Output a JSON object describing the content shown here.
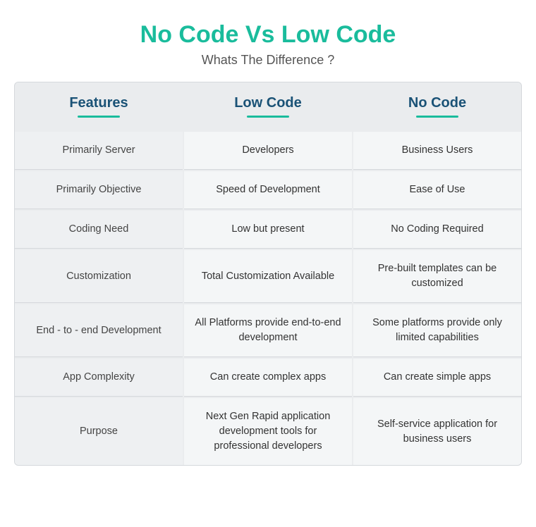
{
  "title": {
    "part1": "No Code Vs ",
    "part2": "Low Code",
    "subtitle": "Whats The Difference ?"
  },
  "headers": {
    "features": "Features",
    "lowcode": "Low Code",
    "nocode": "No Code"
  },
  "rows": [
    {
      "feature": "Primarily Server",
      "lowcode": "Developers",
      "nocode": "Business Users"
    },
    {
      "feature": "Primarily Objective",
      "lowcode": "Speed of Development",
      "nocode": "Ease of Use"
    },
    {
      "feature": "Coding Need",
      "lowcode": "Low but present",
      "nocode": "No Coding Required"
    },
    {
      "feature": "Customization",
      "lowcode": "Total Customization Available",
      "nocode": "Pre-built templates can be customized"
    },
    {
      "feature": "End - to - end Development",
      "lowcode": "All Platforms provide end-to-end development",
      "nocode": "Some platforms provide only limited capabilities"
    },
    {
      "feature": "App Complexity",
      "lowcode": "Can create complex apps",
      "nocode": "Can create simple apps"
    },
    {
      "feature": "Purpose",
      "lowcode": "Next Gen Rapid application development tools for professional developers",
      "nocode": "Self-service application for business users"
    }
  ]
}
